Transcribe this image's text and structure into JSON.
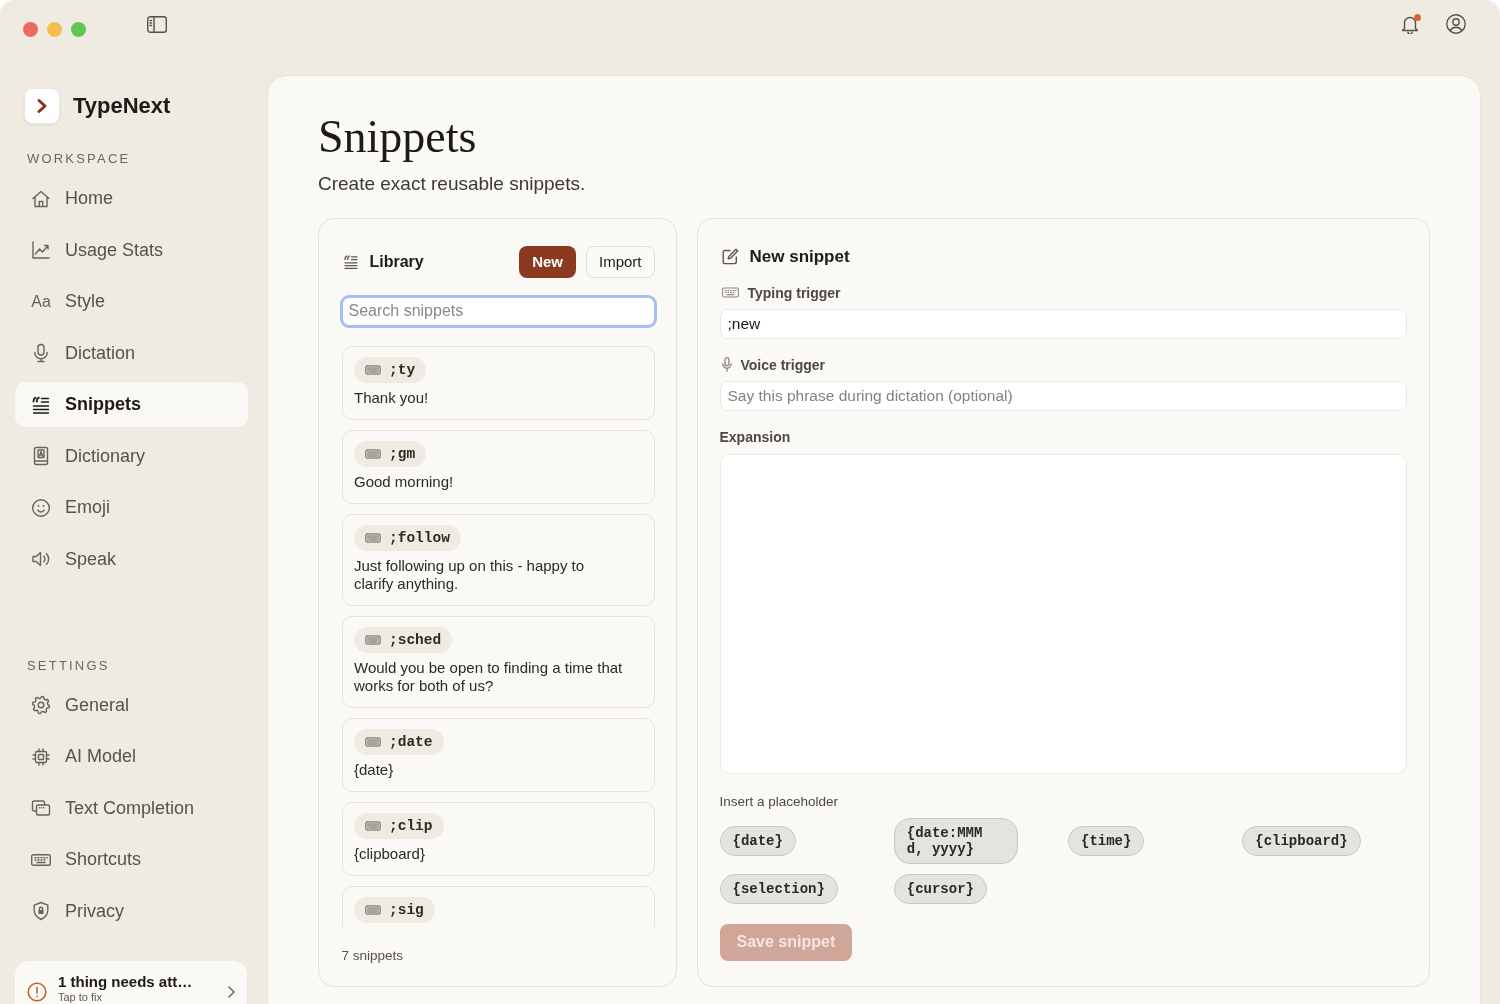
{
  "toolbar": {
    "notification": {
      "unread": true
    }
  },
  "sidebar": {
    "brand": "TypeNext",
    "sections": [
      {
        "title": "WORKSPACE",
        "items": [
          {
            "label": "Home",
            "selected": false
          },
          {
            "label": "Usage Stats",
            "selected": false
          },
          {
            "label": "Style",
            "glyph": "Aa",
            "selected": false
          },
          {
            "label": "Dictation",
            "selected": false
          },
          {
            "label": "Snippets",
            "selected": true
          },
          {
            "label": "Dictionary",
            "selected": false
          },
          {
            "label": "Emoji",
            "selected": false
          },
          {
            "label": "Speak",
            "selected": false
          }
        ]
      },
      {
        "title": "SETTINGS",
        "items": [
          {
            "label": "General",
            "selected": false
          },
          {
            "label": "AI Model",
            "selected": false
          },
          {
            "label": "Text Completion",
            "selected": false
          },
          {
            "label": "Shortcuts",
            "selected": false
          },
          {
            "label": "Privacy",
            "selected": false
          }
        ]
      }
    ],
    "alert": {
      "title": "1 thing needs att…",
      "subtitle": "Tap to fix"
    }
  },
  "page": {
    "title": "Snippets",
    "subtitle": "Create exact reusable snippets."
  },
  "library": {
    "title": "Library",
    "buttons": [
      {
        "label": "New",
        "kind": "primary"
      },
      {
        "label": "Import",
        "kind": "secondary"
      }
    ],
    "search": {
      "placeholder": "Search snippets",
      "focused": true
    },
    "snippets": [
      {
        "trigger": ";ty",
        "text": "Thank you!",
        "selected": false
      },
      {
        "trigger": ";gm",
        "text": "Good morning!",
        "selected": false
      },
      {
        "trigger": ";follow",
        "text": "Just following up on this - happy to clarify anything.",
        "selected": false
      },
      {
        "trigger": ";sched",
        "text": "Would you be open to finding a time that works for both of us?",
        "selected": false
      },
      {
        "trigger": ";date",
        "text": "{date}",
        "selected": false
      },
      {
        "trigger": ";clip",
        "text": "{clipboard}",
        "selected": false
      },
      {
        "trigger": ";sig",
        "selected": false
      }
    ],
    "count": "7 snippets"
  },
  "editor": {
    "title": "New snippet",
    "typing_trigger": {
      "label": "Typing trigger",
      "value": ";new"
    },
    "voice_trigger": {
      "label": "Voice trigger",
      "placeholder": "Say this phrase during dictation (optional)"
    },
    "expansion": {
      "label": "Expansion"
    },
    "placeholders": {
      "label": "Insert a placeholder",
      "items": [
        "{date}",
        "{date:MMM d, yyyy}",
        "{time}",
        "{clipboard}",
        "{selection}",
        "{cursor}"
      ]
    },
    "save_button": {
      "label": "Save snippet",
      "disabled": true
    }
  }
}
